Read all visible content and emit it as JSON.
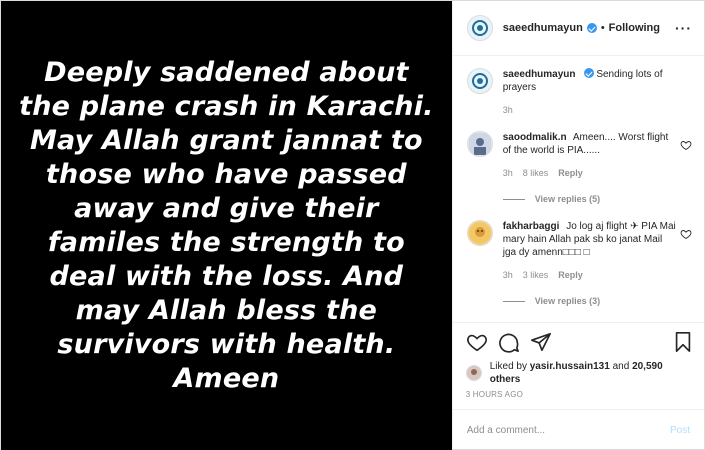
{
  "media": {
    "text": "Deeply saddened about the plane crash in Karachi. May Allah grant jannat to those who have passed away and give their familes the strength to deal with the loss. And may Allah bless the survivors with health. Ameen"
  },
  "header": {
    "username": "saeedhumayun",
    "dot": "•",
    "follow_status": "Following",
    "more": "···"
  },
  "caption": {
    "username": "saeedhumayun",
    "text": "Sending lots of prayers",
    "time": "3h"
  },
  "comments": [
    {
      "username": "saoodmalik.n",
      "text": "Ameen.... Worst flight of the world is PIA......",
      "time": "3h",
      "likes": "8 likes",
      "reply_label": "Reply",
      "view_replies": "View replies (5)"
    },
    {
      "username": "fakharbaggi",
      "text": "Jo log aj flight ✈ PIA Mai mary hain Allah pak sb ko janat Mail jga dy amenn□□□ □",
      "time": "3h",
      "likes": "3 likes",
      "reply_label": "Reply",
      "view_replies": "View replies (3)"
    }
  ],
  "likes": {
    "prefix": "Liked by",
    "user": "yasir.hussain131",
    "and": "and",
    "others": "20,590 others"
  },
  "timestamp": "3 HOURS AGO",
  "add_comment": {
    "placeholder": "Add a comment...",
    "post_label": "Post"
  },
  "icons": [
    "more-options-icon",
    "verified-badge-icon",
    "heart-icon",
    "comment-icon",
    "share-icon",
    "bookmark-icon"
  ]
}
